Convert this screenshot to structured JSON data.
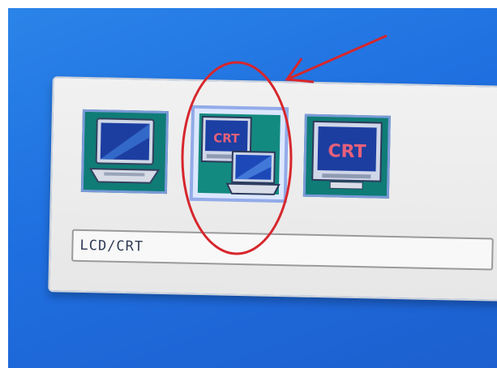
{
  "window": {
    "label_field": "LCD/CRT"
  },
  "icons": {
    "lcd": {
      "name": "laptop-lcd-icon",
      "text": ""
    },
    "clone": {
      "name": "crt-clone-icon",
      "text": "CRT"
    },
    "crt": {
      "name": "crt-monitor-icon",
      "text": "CRT"
    }
  },
  "annotation": {
    "highlight_color": "#d7262c"
  },
  "colors": {
    "desktop_blue": "#1f6fe0",
    "panel_grey": "#ececec",
    "icon_teal": "#0f7c76",
    "crt_red": "#d44a62"
  }
}
